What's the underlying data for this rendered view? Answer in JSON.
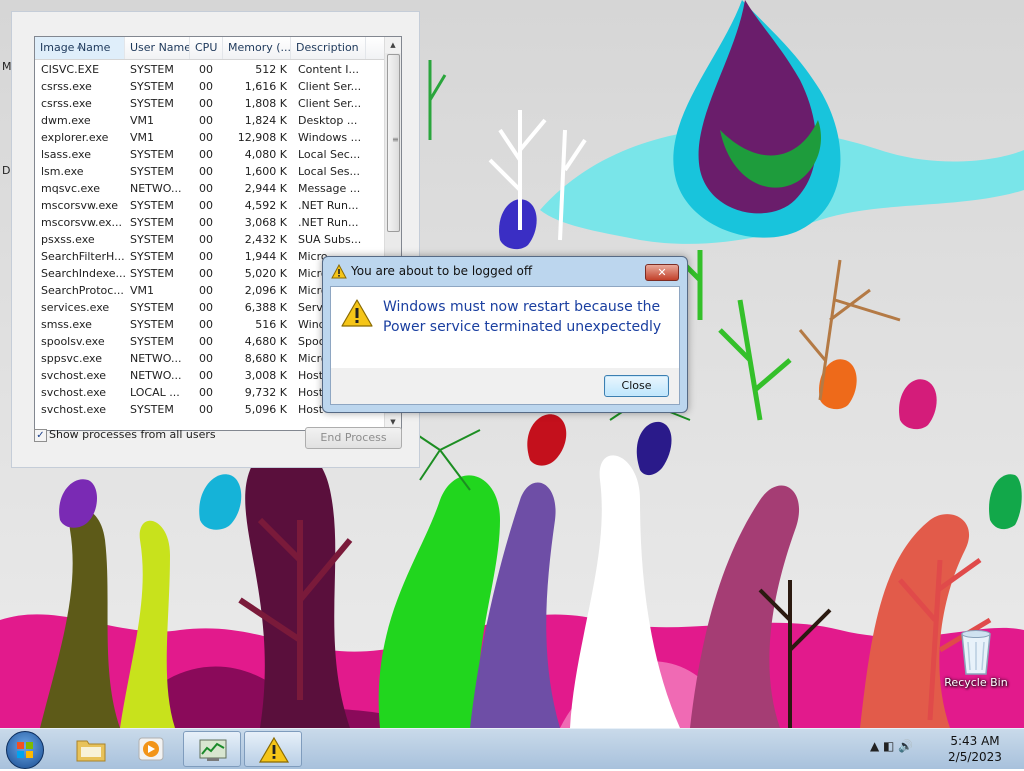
{
  "task_manager": {
    "columns": [
      "Image Name",
      "User Name",
      "CPU",
      "Memory (...",
      "Description"
    ],
    "processes": [
      [
        "CISVC.EXE",
        "SYSTEM",
        "00",
        "512 K",
        "Content I..."
      ],
      [
        "csrss.exe",
        "SYSTEM",
        "00",
        "1,616 K",
        "Client Ser..."
      ],
      [
        "csrss.exe",
        "SYSTEM",
        "00",
        "1,808 K",
        "Client Ser..."
      ],
      [
        "dwm.exe",
        "VM1",
        "00",
        "1,824 K",
        "Desktop ..."
      ],
      [
        "explorer.exe",
        "VM1",
        "00",
        "12,908 K",
        "Windows ..."
      ],
      [
        "lsass.exe",
        "SYSTEM",
        "00",
        "4,080 K",
        "Local Sec..."
      ],
      [
        "lsm.exe",
        "SYSTEM",
        "00",
        "1,600 K",
        "Local Ses..."
      ],
      [
        "mqsvc.exe",
        "NETWO...",
        "00",
        "2,944 K",
        "Message ..."
      ],
      [
        "mscorsvw.exe",
        "SYSTEM",
        "00",
        "4,592 K",
        ".NET Run..."
      ],
      [
        "mscorsvw.ex...",
        "SYSTEM",
        "00",
        "3,068 K",
        ".NET Run..."
      ],
      [
        "psxss.exe",
        "SYSTEM",
        "00",
        "2,432 K",
        "SUA Subs..."
      ],
      [
        "SearchFilterH...",
        "SYSTEM",
        "00",
        "1,944 K",
        "Micro"
      ],
      [
        "SearchIndexe...",
        "SYSTEM",
        "00",
        "5,020 K",
        "Micro"
      ],
      [
        "SearchProtoc...",
        "VM1",
        "00",
        "2,096 K",
        "Micro"
      ],
      [
        "services.exe",
        "SYSTEM",
        "00",
        "6,388 K",
        "Servi"
      ],
      [
        "smss.exe",
        "SYSTEM",
        "00",
        "516 K",
        "Wind"
      ],
      [
        "spoolsv.exe",
        "SYSTEM",
        "00",
        "4,680 K",
        "Spoo"
      ],
      [
        "sppsvc.exe",
        "NETWO...",
        "00",
        "8,680 K",
        "Micro"
      ],
      [
        "svchost.exe",
        "NETWO...",
        "00",
        "3,008 K",
        "Host"
      ],
      [
        "svchost.exe",
        "LOCAL ...",
        "00",
        "9,732 K",
        "Host"
      ],
      [
        "svchost.exe",
        "SYSTEM",
        "00",
        "5,096 K",
        "Host"
      ]
    ],
    "show_all_label": "Show processes from all users",
    "show_all_checked": true,
    "end_process_label": "End Process"
  },
  "dialog": {
    "title": "You are about to be logged off",
    "message": "Windows must now restart because the Power service terminated unexpectedly",
    "close_label": "Close",
    "close_glyph": "✕"
  },
  "desktop": {
    "recycle_bin_label": "Recycle Bin",
    "edge_letters": [
      "M",
      "D"
    ]
  },
  "taskbar": {
    "clock_time": "5:43 AM",
    "clock_date": "2/5/2023",
    "tray_glyphs": "▲  ◧  🔊"
  }
}
